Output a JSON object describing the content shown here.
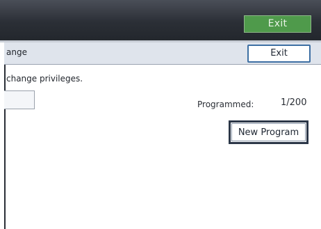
{
  "topbar": {
    "exit_label": "Exit"
  },
  "panel": {
    "header_text": "ange",
    "exit_label": "Exit",
    "info_text": "change privileges.",
    "field_value": "",
    "programmed_label": "Programmed:",
    "programmed_value": "1/200",
    "new_program_label": "New Program"
  },
  "colors": {
    "topbar": "#2b2f36",
    "exit_top_green": "#4f9a4b",
    "exit_border_blue": "#3d6fa3",
    "header_strip": "#dfe4ec"
  }
}
